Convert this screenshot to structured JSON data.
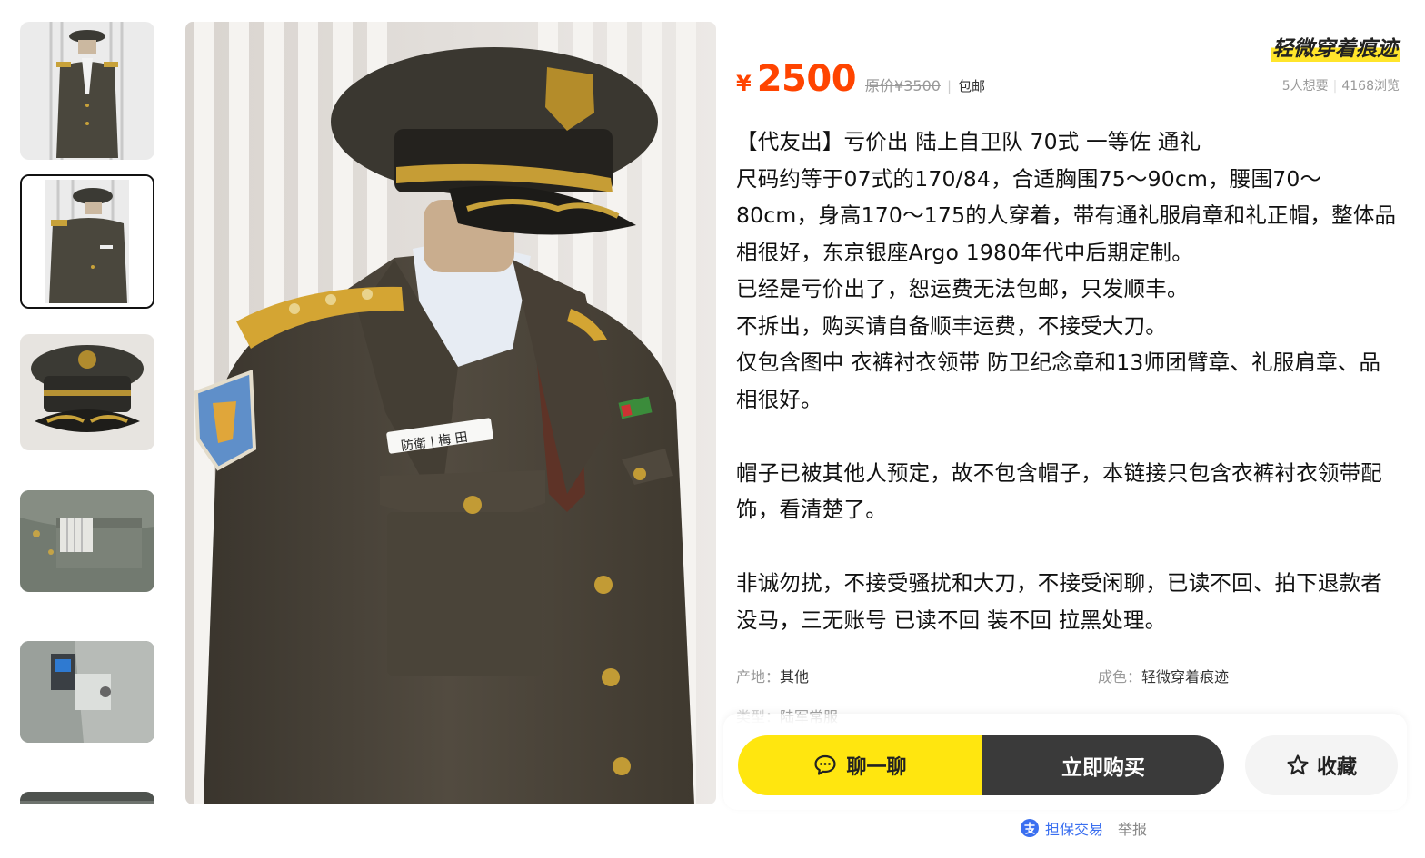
{
  "thumbnails": [
    {
      "name": "thumb-uniform-front",
      "selected": false
    },
    {
      "name": "thumb-uniform-side",
      "selected": true
    },
    {
      "name": "thumb-cap",
      "selected": false
    },
    {
      "name": "thumb-pocket-detail",
      "selected": false
    },
    {
      "name": "thumb-label-detail",
      "selected": false
    },
    {
      "name": "thumb-more",
      "selected": false
    }
  ],
  "main_image": {
    "name_tag_text": "防衛 | 梅 田"
  },
  "product": {
    "condition": "轻微穿着痕迹",
    "currency": "¥",
    "price": "2500",
    "original_price": "原价¥3500",
    "separator": "|",
    "shipping": "包邮",
    "wants": "5人想要",
    "views": "4168浏览"
  },
  "description": [
    "【代友出】亏价出 陆上自卫队 70式 一等佐 通礼",
    "尺码约等于07式的170/84，合适胸围75～90cm，腰围70～80cm，身高170～175的人穿着，带有通礼服肩章和礼正帽，整体品相很好，东京银座Argo 1980年代中后期定制。",
    "已经是亏价出了，恕运费无法包邮，只发顺丰。",
    "不拆出，购买请自备顺丰运费，不接受大刀。",
    "仅包含图中 衣裤衬衣领带 防卫纪念章和13师团臂章、礼服肩章、品相很好。",
    "",
    "帽子已被其他人预定，故不包含帽子，本链接只包含衣裤衬衣领带配饰，看清楚了。",
    "",
    "非诚勿扰，不接受骚扰和大刀，不接受闲聊，已读不回、拍下退款者没马，三无账号 已读不回 装不回 拉黑处理。"
  ],
  "attributes": {
    "origin_key": "产地：",
    "origin_value": "其他",
    "condition_key": "成色：",
    "condition_value": "轻微穿着痕迹",
    "partial_key": "类型：",
    "partial_value": "陆军常服"
  },
  "actions": {
    "chat_label": "聊一聊",
    "buy_label": "立即购买",
    "favorite_label": "收藏",
    "guarantee_label": "担保交易",
    "report_label": "举报"
  },
  "colors": {
    "price": "#ff4400",
    "chat_button": "#ffe60f",
    "buy_button": "#3a3a3a",
    "guarantee": "#3a6ff0"
  }
}
